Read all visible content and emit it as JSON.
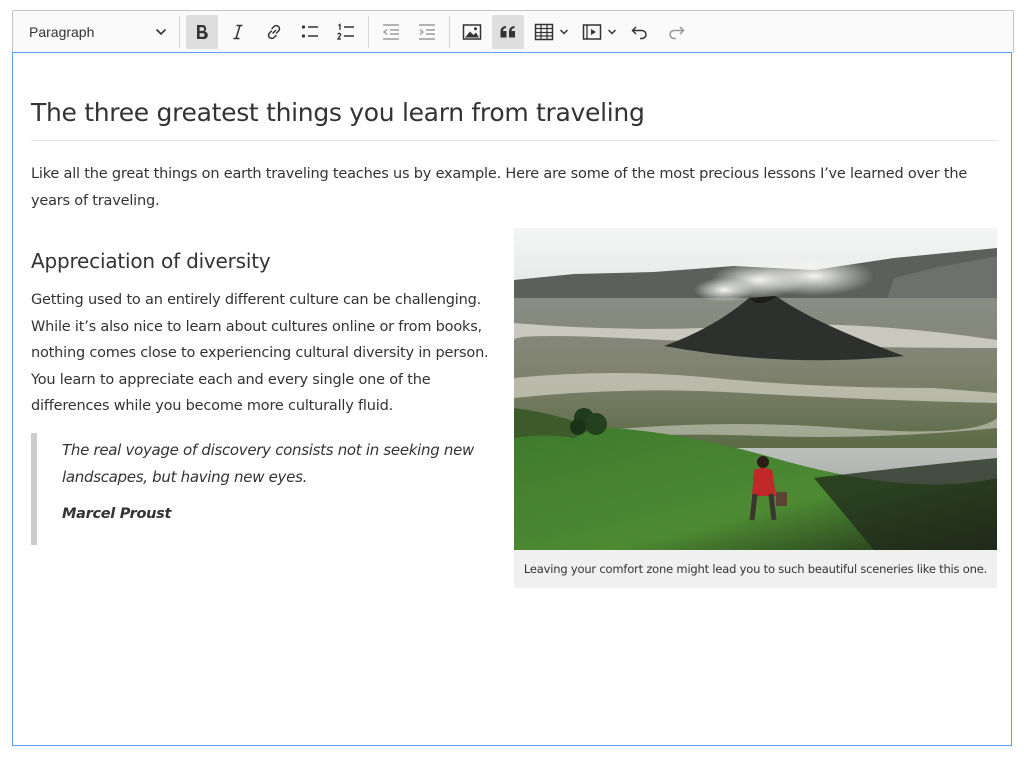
{
  "toolbar": {
    "heading_value": "Paragraph",
    "buttons": [
      "bold-icon",
      "italic-icon",
      "link-icon",
      "bulleted-list-icon",
      "numbered-list-icon",
      "outdent-icon",
      "indent-icon",
      "image-icon",
      "block-quote-icon",
      "table-icon",
      "media-icon",
      "undo-icon",
      "redo-icon"
    ],
    "active": [
      "bold",
      "block-quote"
    ]
  },
  "document": {
    "title": "The three greatest things you learn from traveling",
    "intro": "Like all the great things on earth traveling teaches us by example. Here are some of the most precious lessons I’ve learned over the years of traveling.",
    "section_heading": "Appreciation of diversity",
    "section_body": "Getting used to an entirely different culture can be challenging. While it’s also nice to learn about cultures online or from books, nothing comes close to experiencing cultural diversity in person. You learn to appreciate each and every single one of the differences while you become more culturally fluid.",
    "quote": {
      "text": "The real voyage of discovery consists not in seeking new landscapes, but having new eyes.",
      "author": "Marcel Proust"
    },
    "figure": {
      "caption": "Leaving your comfort zone might lead you to such beautiful sceneries like this one.",
      "alt_icon": "landscape-photo"
    }
  },
  "colors": {
    "focus_border": "#5d9cec",
    "toolbar_bg": "#fafafa",
    "active_button": "#dedede",
    "quote_border": "#cccccc"
  }
}
